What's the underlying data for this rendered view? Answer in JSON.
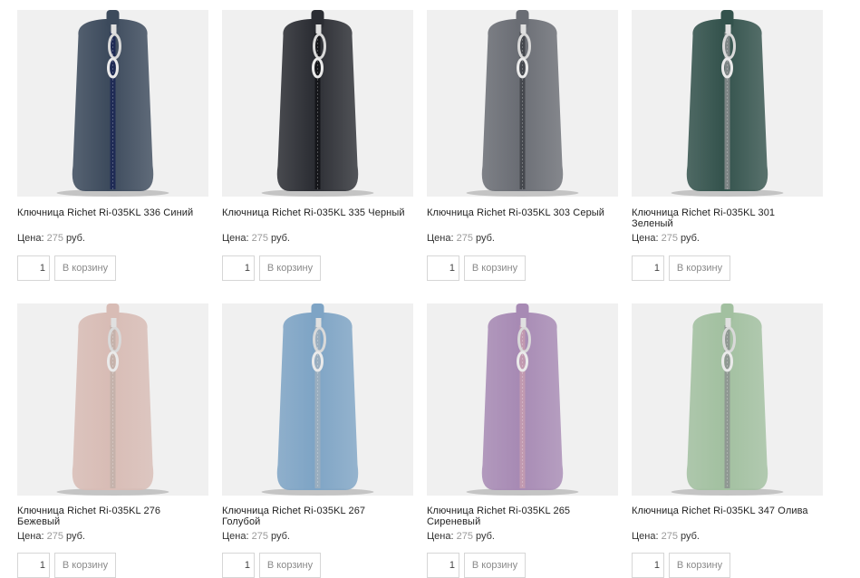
{
  "product_grid": {
    "price_label": "Цена:",
    "currency": "руб.",
    "cart_button_label": "В корзину",
    "products": [
      {
        "title": "Ключница Richet Ri-035KL 336 Синий",
        "price": "275",
        "qty": "1",
        "color": "#3c4a5c",
        "zipper": "#1f2b55",
        "puller": "silver"
      },
      {
        "title": "Ключница Richet Ri-035KL 335 Черный",
        "price": "275",
        "qty": "1",
        "color": "#2b2d33",
        "zipper": "#15161a",
        "puller": "silver"
      },
      {
        "title": "Ключница Richet Ri-035KL 303 Серый",
        "price": "275",
        "qty": "1",
        "color": "#6a6d74",
        "zipper": "#45484e",
        "puller": "silver"
      },
      {
        "title": "Ключница Richet Ri-035KL 301 Зеленый",
        "price": "275",
        "qty": "1",
        "color": "#33524c",
        "zipper": "#7d8585",
        "puller": "silver"
      },
      {
        "title": "Ключница Richet Ri-035KL 276 Бежевый",
        "price": "275",
        "qty": "1",
        "color": "#d8bcb5",
        "zipper": "#c5b2ab",
        "puller": "silver"
      },
      {
        "title": "Ключница Richet Ri-035KL 267 Голубой",
        "price": "275",
        "qty": "1",
        "color": "#7ea4c5",
        "zipper": "#9aaebf",
        "puller": "silver"
      },
      {
        "title": "Ключница Richet Ri-035KL 265 Сиреневый",
        "price": "275",
        "qty": "1",
        "color": "#a78ab4",
        "zipper": "#c29ab0",
        "puller": "silver"
      },
      {
        "title": "Ключница Richet Ri-035KL 347 Олива",
        "price": "275",
        "qty": "1",
        "color": "#a2c0a0",
        "zipper": "#8f9892",
        "puller": "silver"
      }
    ]
  }
}
